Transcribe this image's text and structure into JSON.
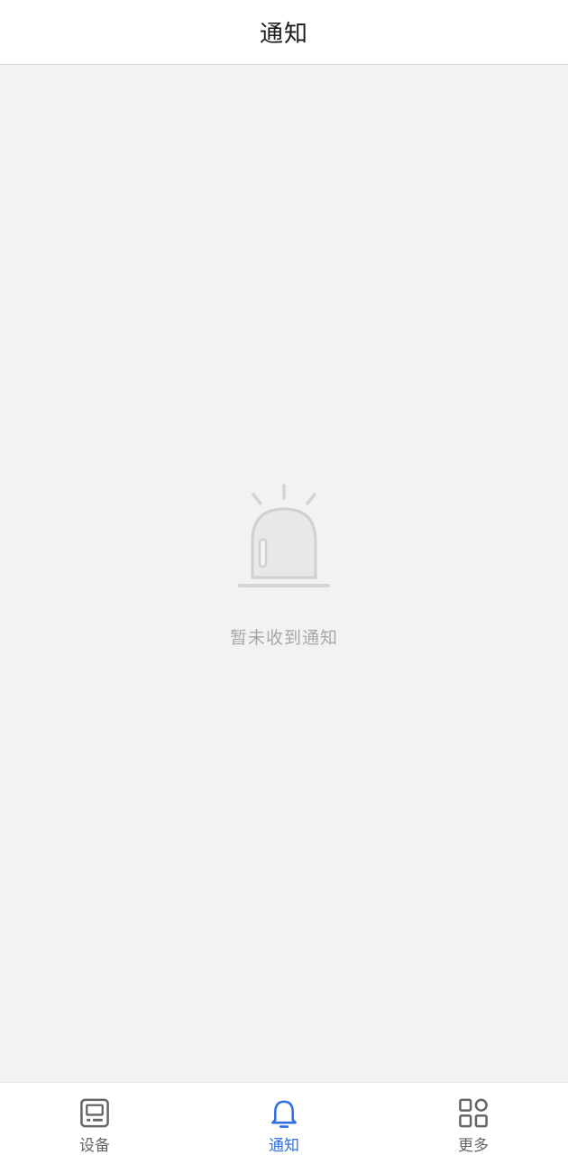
{
  "header": {
    "title": "通知"
  },
  "empty_state": {
    "icon": "alarm-light-icon",
    "message": "暂未收到通知"
  },
  "tabbar": {
    "active_tab": "notifications",
    "tabs": [
      {
        "id": "devices",
        "label": "设备",
        "icon": "device-icon"
      },
      {
        "id": "notifications",
        "label": "通知",
        "icon": "bell-icon"
      },
      {
        "id": "more",
        "label": "更多",
        "icon": "grid-icon"
      }
    ]
  },
  "colors": {
    "accent": "#2f6fe0",
    "inactive": "#666666",
    "background": "#f2f2f2",
    "empty_text": "#a8a8a8"
  }
}
